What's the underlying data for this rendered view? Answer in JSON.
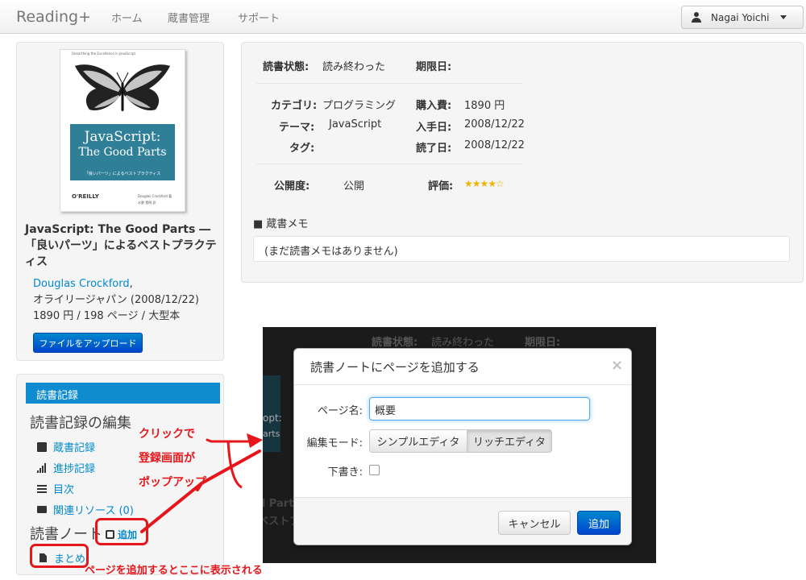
{
  "navbar": {
    "brand": "Reading+",
    "items": [
      {
        "label": "ホーム"
      },
      {
        "label": "蔵書管理"
      },
      {
        "label": "サポート"
      }
    ],
    "user": "Nagai Yoichi"
  },
  "book": {
    "cover": {
      "top_text": "Unearthing the Excellence in JavaScript",
      "title_line1": "JavaScript:",
      "title_line2": "The Good Parts",
      "subtitle": "「良いパーツ」によるベストプラクティス",
      "publisher_logo": "O'REILLY",
      "author_line1": "Douglas Crockford 著",
      "author_line2": "水野 貴明 訳"
    },
    "title": "JavaScript: The Good Parts ―「良いパーツ」によるベストプラクティス",
    "author": "Douglas Crockford",
    "author_suffix": ",",
    "publisher": "オライリージャパン (2008/12/22)",
    "info": "1890 円 / 198 ページ / 大型本",
    "upload_label": "ファイルをアップロード"
  },
  "record": {
    "header": "読書記録",
    "edit_heading": "読書記録の編集",
    "items": [
      {
        "label": "蔵書記録",
        "icon": "book-icon"
      },
      {
        "label": "進捗記録",
        "icon": "bar-chart-icon"
      },
      {
        "label": "目次",
        "icon": "list-icon"
      },
      {
        "label": "関連リソース (0)",
        "icon": "folder-icon"
      }
    ],
    "note_heading": "読書ノート",
    "add_label": "追加",
    "note_item": "まとめ"
  },
  "details": {
    "status_label": "読書状態:",
    "status_value": "読み終わった",
    "due_label": "期限日:",
    "due_value": "",
    "category_label": "カテゴリ:",
    "category_value": "プログラミング",
    "price_label": "購入費:",
    "price_value": "1890 円",
    "theme_label": "テーマ:",
    "theme_value": "JavaScript",
    "acquired_label": "入手日:",
    "acquired_value": "2008/12/22",
    "tag_label": "タグ:",
    "tag_value": "",
    "finished_label": "読了日:",
    "finished_value": "2008/12/22",
    "public_label": "公開度:",
    "public_value": "公開",
    "rating_label": "評価:",
    "rating": 4,
    "rating_max": 5,
    "stars_text": "★★★★☆",
    "memo_title": "■ 蔵書メモ",
    "memo_text": "(まだ読書メモはありません)"
  },
  "overlay": {
    "status_label": "読書状態:",
    "status_value": "読み終わった",
    "due_label": "期限日:",
    "partial_1": "d Part",
    "partial_2": "ベストプ",
    "partial_3": "opt:",
    "partial_4": "arts"
  },
  "modal": {
    "title": "読書ノートにページを追加する",
    "close": "×",
    "page_name_label": "ページ名:",
    "page_name_value": "概要",
    "mode_label": "編集モード:",
    "mode_simple": "シンプルエディタ",
    "mode_rich": "リッチエディタ",
    "mode_selected": "リッチエディタ",
    "draft_label": "下書き:",
    "draft_checked": false,
    "cancel_label": "キャンセル",
    "add_label": "追加"
  },
  "annotations": {
    "click_line1": "クリックで",
    "click_line2": "登録画面が",
    "click_line3": "ポップアップ",
    "bottom_text": "ページを追加するとここに表示される",
    "color": "#e6161b"
  }
}
